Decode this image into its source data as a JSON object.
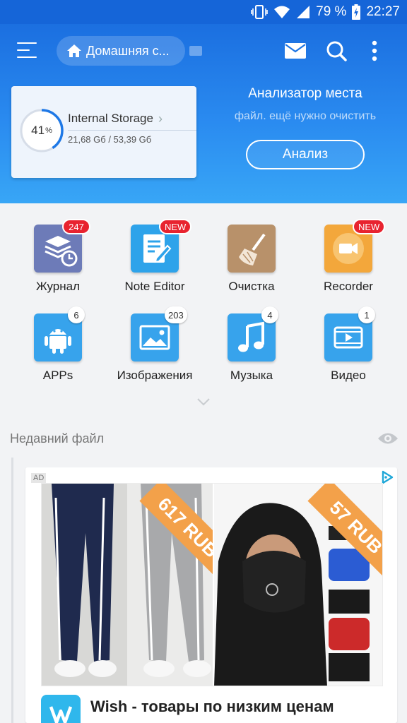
{
  "status_bar": {
    "battery": "79 %",
    "time": "22:27"
  },
  "header": {
    "breadcrumb_label": "Домашняя с...",
    "storage": {
      "name": "Internal Storage",
      "percent_value": "41",
      "percent_sign": "%",
      "percent_used": 41,
      "size": "21,68 Gб / 53,39 Gб"
    },
    "analyzer": {
      "title": "Анализатор места",
      "subtitle": "файл. ещё нужно очистить",
      "button": "Анализ"
    }
  },
  "grid": [
    {
      "label": "Журнал",
      "badge": "247",
      "badge_type": "red",
      "icon": "history-icon",
      "color": "#6d7bb8"
    },
    {
      "label": "Note Editor",
      "badge": "NEW",
      "badge_type": "red",
      "icon": "note-editor-icon",
      "color": "#2ea3ea"
    },
    {
      "label": "Очистка",
      "badge": "",
      "badge_type": "none",
      "icon": "broom-icon",
      "color": "#b8916a"
    },
    {
      "label": "Recorder",
      "badge": "NEW",
      "badge_type": "red",
      "icon": "video-recorder-icon",
      "color": "#f3a73b"
    },
    {
      "label": "APPs",
      "badge": "6",
      "badge_type": "white",
      "icon": "android-icon",
      "color": "#37a3ec"
    },
    {
      "label": "Изображения",
      "badge": "203",
      "badge_type": "white",
      "icon": "image-icon",
      "color": "#37a3ec"
    },
    {
      "label": "Музыка",
      "badge": "4",
      "badge_type": "white",
      "icon": "music-icon",
      "color": "#37a3ec"
    },
    {
      "label": "Видео",
      "badge": "1",
      "badge_type": "white",
      "icon": "video-icon",
      "color": "#37a3ec"
    }
  ],
  "recent": {
    "title": "Недавний файл"
  },
  "ad": {
    "tag": "AD",
    "price_left": "617 RUB",
    "price_right": "57 RUB",
    "headline": "Wish -  товары по низким ценам"
  }
}
